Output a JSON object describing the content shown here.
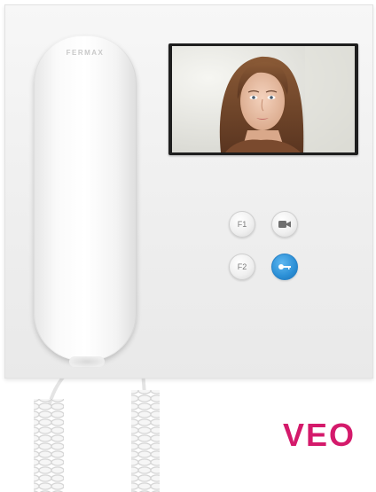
{
  "handset": {
    "logo": "FERMAX"
  },
  "buttons": {
    "f1_label": "F1",
    "f2_label": "F2",
    "camera_icon": "camera-icon",
    "key_icon": "key-icon"
  },
  "brand": {
    "logo_text": "VEO",
    "color": "#d41a6b"
  },
  "colors": {
    "key_button": "#2b8fd6",
    "panel": "#f1f1f1"
  }
}
